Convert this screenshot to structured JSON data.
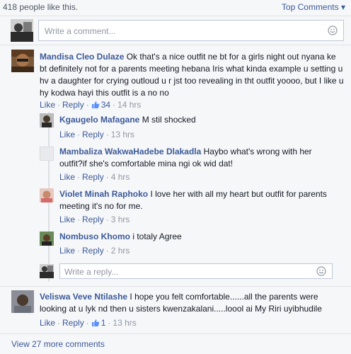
{
  "header": {
    "likes_text": "418 people like this.",
    "top_comments_label": "Top Comments",
    "top_comments_arrow": "▾"
  },
  "composer": {
    "placeholder": "Write a comment..."
  },
  "comments": [
    {
      "author": "Mandisa Cleo Dulaze",
      "text": "Ok that's a nice outfit ne bt for a girls night out nyana ke bt definitely not for a parents meeting hebana Iris what kinda example u setting u hv a daughter for crying outloud u r jst too revealing in tht outfit yoooo, but I like u hy kodwa hayi this outfit is a no no",
      "like_label": "Like",
      "reply_label": "Reply",
      "like_count": "34",
      "time": "14 hrs"
    },
    {
      "author": "Veliswa Veve Ntilashe",
      "text": "I hope you felt comfortable......all the parents were looking at u lyk nd then u sisters kwenzakalani.....loool ai My Riri uyibhudile",
      "like_label": "Like",
      "reply_label": "Reply",
      "like_count": "1",
      "time": "13 hrs"
    }
  ],
  "replies": [
    {
      "author": "Kgaugelo Mafagane",
      "text": "M stil shocked",
      "like_label": "Like",
      "reply_label": "Reply",
      "time": "13 hrs"
    },
    {
      "author": "Mambaliza WakwaHadebe Dlakadla",
      "text": "Haybo what's wrong with her outfit?if she's comfortable mina ngi ok wid dat!",
      "like_label": "Like",
      "reply_label": "Reply",
      "time": "4 hrs"
    },
    {
      "author": "Violet Minah Raphoko",
      "text": "I love her with all my heart but outfit for parents meeting it's no for me.",
      "like_label": "Like",
      "reply_label": "Reply",
      "time": "3 hrs"
    },
    {
      "author": "Nombuso Khomo",
      "text": "i totaly Agree",
      "like_label": "Like",
      "reply_label": "Reply",
      "time": "2 hrs"
    }
  ],
  "reply_composer": {
    "placeholder": "Write a reply..."
  },
  "footer": {
    "view_more": "View 27 more comments"
  },
  "colors": {
    "link": "#3b5998",
    "meta": "#9197a3",
    "background": "#f6f7f9"
  }
}
